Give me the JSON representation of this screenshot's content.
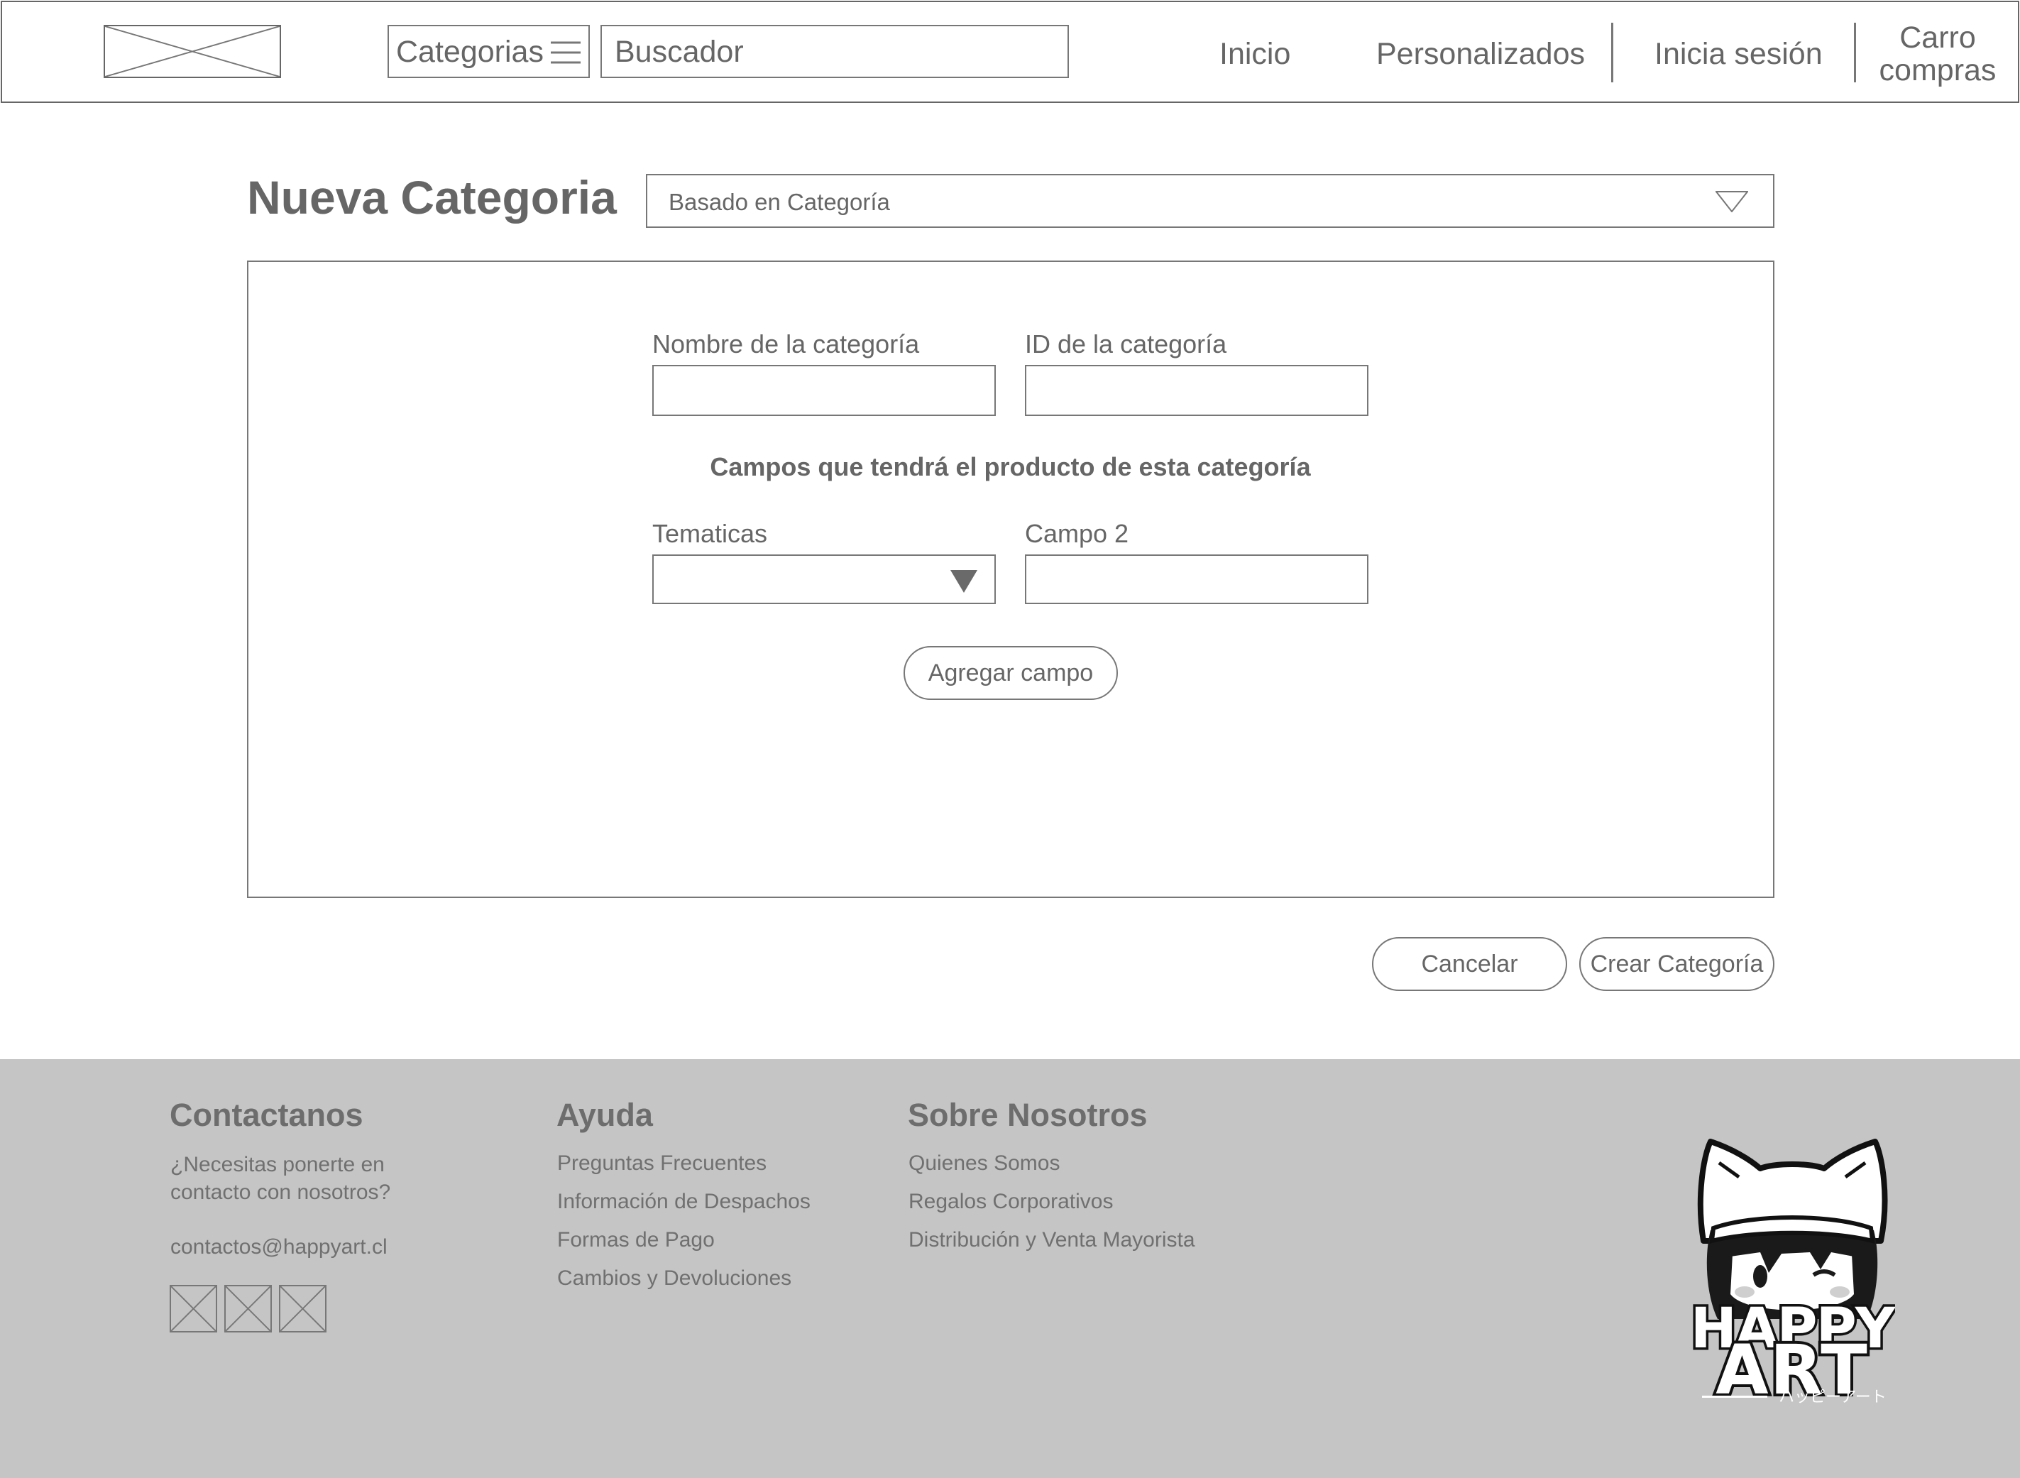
{
  "header": {
    "logo_icon": "image-placeholder-icon",
    "categories_label": "Categorias",
    "categories_icon": "hamburger-menu-icon",
    "search_placeholder": "Buscador",
    "nav": {
      "home": "Inicio",
      "custom": "Personalizados",
      "login": "Inicia sesión",
      "cart_line1": "Carro",
      "cart_line2": "compras"
    }
  },
  "main": {
    "title": "Nueva Categoria",
    "based_on_select": {
      "value": "Basado en Categoría",
      "icon": "dropdown-triangle-outline-icon"
    },
    "form": {
      "name_label": "Nombre de la categoría",
      "name_value": "",
      "id_label": "ID de la categoría",
      "id_value": "",
      "section_heading": "Campos que tendrá el producto de esta categoría",
      "themes_label": "Tematicas",
      "themes_value": "",
      "themes_icon": "dropdown-triangle-filled-icon",
      "field2_label": "Campo 2",
      "field2_value": "",
      "add_field_button": "Agregar campo"
    },
    "actions": {
      "cancel": "Cancelar",
      "create": "Crear Categoría"
    }
  },
  "footer": {
    "contact": {
      "heading": "Contactanos",
      "text_line1": "¿Necesitas ponerte en",
      "text_line2": "contacto con nosotros?",
      "email": "contactos@happyart.cl",
      "social_icons": [
        "social-placeholder-icon",
        "social-placeholder-icon",
        "social-placeholder-icon"
      ]
    },
    "help": {
      "heading": "Ayuda",
      "links": [
        "Preguntas Frecuentes",
        "Información de Despachos",
        "Formas de Pago",
        "Cambios y Devoluciones"
      ]
    },
    "about": {
      "heading": "Sobre Nosotros",
      "links": [
        "Quienes Somos",
        "Regalos Corporativos",
        "Distribución y Venta Mayorista"
      ]
    },
    "brand_logo": {
      "line1": "HAPPY",
      "line2": "ART",
      "subtitle": "ハッピーアート",
      "icon": "happy-art-mascot-logo"
    }
  },
  "colors": {
    "wire_gray": "#666666",
    "footer_bg": "#c5c5c5",
    "page_bg": "#ffffff"
  }
}
